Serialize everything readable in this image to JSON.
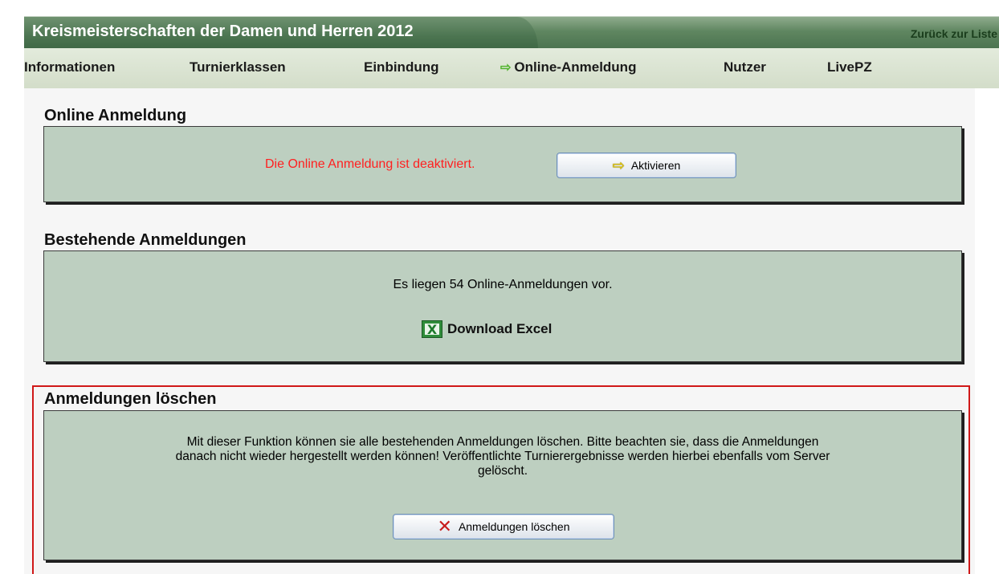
{
  "header": {
    "title": "Kreismeisterschaften der Damen und Herren 2012",
    "back_link": "Zurück zur Liste"
  },
  "nav": {
    "items": [
      {
        "label": "Informationen",
        "active": false
      },
      {
        "label": "Turnierklassen",
        "active": false
      },
      {
        "label": "Einbindung",
        "active": false
      },
      {
        "label": "Online-Anmeldung",
        "active": true
      },
      {
        "label": "Nutzer",
        "active": false
      },
      {
        "label": "LivePZ",
        "active": false
      }
    ],
    "active_arrow": "⇨"
  },
  "online_anmeldung": {
    "heading": "Online Anmeldung",
    "status_text": "Die Online Anmeldung ist deaktiviert.",
    "button_label": "Aktivieren",
    "button_icon": "yellow-arrow-right-icon"
  },
  "bestehende": {
    "heading": "Bestehende Anmeldungen",
    "count_text": "Es liegen 54 Online-Anmeldungen vor.",
    "download_label": "Download Excel",
    "download_icon": "excel-icon"
  },
  "loeschen": {
    "heading": "Anmeldungen löschen",
    "line1": "Mit dieser Funktion können sie alle bestehenden Anmeldungen löschen. Bitte beachten sie, dass die Anmeldungen",
    "line2": "danach nicht wieder hergestellt werden können! Veröffentlichte Turnierergebnisse werden hierbei ebenfalls vom Server",
    "line3": "gelöscht.",
    "button_label": "Anmeldungen löschen",
    "button_icon": "red-x-icon"
  },
  "colors": {
    "titlebar": "#4b7350",
    "nav_bg": "#d3ddc9",
    "panel_bg": "#bdcfc0",
    "alert_red": "#ff2020",
    "danger_border": "#d01818",
    "active_arrow": "#4fb32b"
  }
}
